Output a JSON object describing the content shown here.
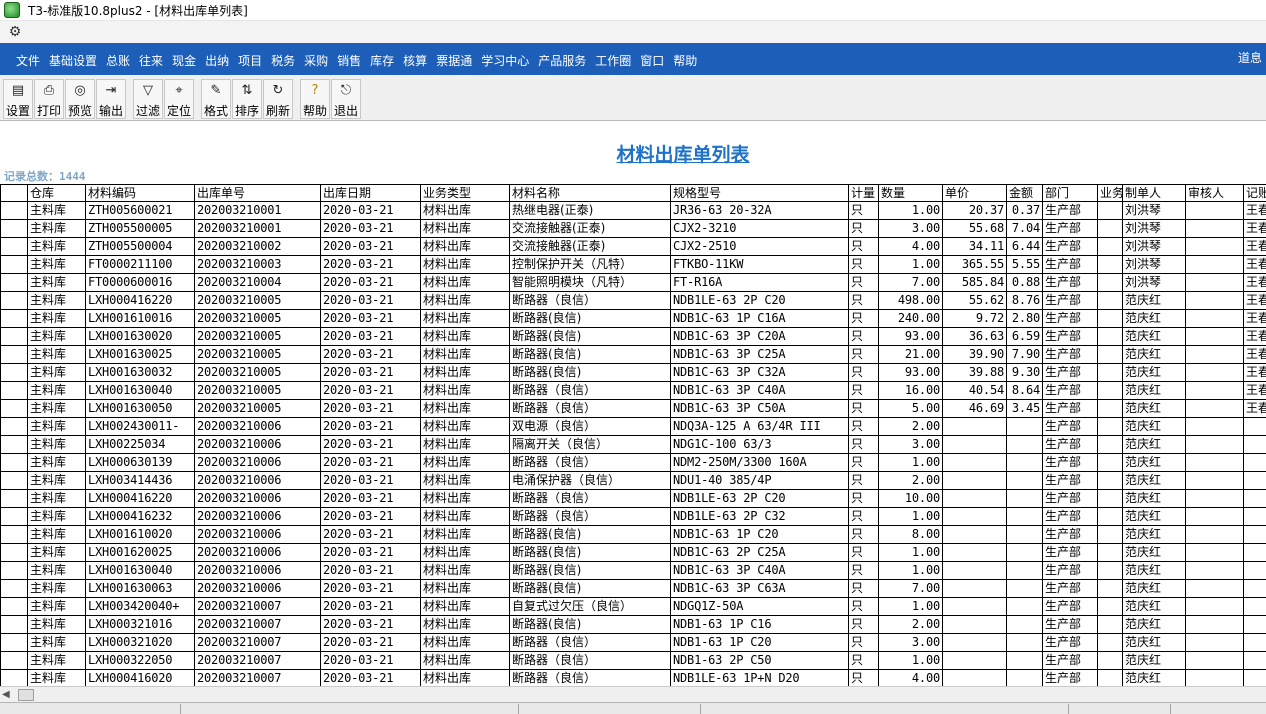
{
  "window": {
    "title": "T3-标准版10.8plus2 - [材料出库单列表]"
  },
  "menubar": {
    "items": [
      "文件",
      "基础设置",
      "总账",
      "往来",
      "现金",
      "出纳",
      "项目",
      "税务",
      "采购",
      "销售",
      "库存",
      "核算",
      "票据通",
      "学习中心",
      "产品服务",
      "工作圈",
      "窗口",
      "帮助"
    ],
    "user": "道息"
  },
  "toolbar": {
    "buttons": [
      {
        "label": "设置",
        "icon": "setup-icon"
      },
      {
        "label": "打印",
        "icon": "print-icon"
      },
      {
        "label": "预览",
        "icon": "preview-icon"
      },
      {
        "label": "输出",
        "icon": "export-icon"
      },
      {
        "label": "过滤",
        "icon": "filter-icon"
      },
      {
        "label": "定位",
        "icon": "locate-icon"
      },
      {
        "label": "格式",
        "icon": "format-icon"
      },
      {
        "label": "排序",
        "icon": "sort-icon"
      },
      {
        "label": "刷新",
        "icon": "refresh-icon"
      },
      {
        "label": "帮助",
        "icon": "help-icon"
      },
      {
        "label": "退出",
        "icon": "exit-icon"
      }
    ]
  },
  "report": {
    "title": "材料出库单列表",
    "record_count": "记录总数：1444",
    "columns": [
      "仓库",
      "材料编码",
      "出库单号",
      "出库日期",
      "业务类型",
      "材料名称",
      "规格型号",
      "计量",
      "数量",
      "单价",
      "金额",
      "部门",
      "业务",
      "制单人",
      "审核人",
      "记账"
    ],
    "rows": [
      [
        "主料库",
        "ZTH005600021",
        "202003210001",
        "2020-03-21",
        "材料出库",
        "热继电器(正泰)",
        "JR36-63 20-32A",
        "只",
        "1.00",
        "20.37",
        "0.37",
        "生产部",
        "",
        "刘洪琴",
        "",
        "王春"
      ],
      [
        "主料库",
        "ZTH005500005",
        "202003210001",
        "2020-03-21",
        "材料出库",
        "交流接触器(正泰)",
        "CJX2-3210",
        "只",
        "3.00",
        "55.68",
        "7.04",
        "生产部",
        "",
        "刘洪琴",
        "",
        "王春"
      ],
      [
        "主料库",
        "ZTH005500004",
        "202003210002",
        "2020-03-21",
        "材料出库",
        "交流接触器(正泰)",
        "CJX2-2510",
        "只",
        "4.00",
        "34.11",
        "6.44",
        "生产部",
        "",
        "刘洪琴",
        "",
        "王春"
      ],
      [
        "主料库",
        "FT0000211100",
        "202003210003",
        "2020-03-21",
        "材料出库",
        "控制保护开关（凡特）",
        "FTKBO-11KW",
        "只",
        "1.00",
        "365.55",
        "5.55",
        "生产部",
        "",
        "刘洪琴",
        "",
        "王春"
      ],
      [
        "主料库",
        "FT0000600016",
        "202003210004",
        "2020-03-21",
        "材料出库",
        "智能照明模块（凡特）",
        "FT-R16A",
        "只",
        "7.00",
        "585.84",
        "0.88",
        "生产部",
        "",
        "刘洪琴",
        "",
        "王春"
      ],
      [
        "主料库",
        "LXH000416220",
        "202003210005",
        "2020-03-21",
        "材料出库",
        "断路器（良信）",
        "NDB1LE-63 2P C20",
        "只",
        "498.00",
        "55.62",
        "8.76",
        "生产部",
        "",
        "范庆红",
        "",
        "王春"
      ],
      [
        "主料库",
        "LXH001610016",
        "202003210005",
        "2020-03-21",
        "材料出库",
        "断路器(良信)",
        "NDB1C-63 1P C16A",
        "只",
        "240.00",
        "9.72",
        "2.80",
        "生产部",
        "",
        "范庆红",
        "",
        "王春"
      ],
      [
        "主料库",
        "LXH001630020",
        "202003210005",
        "2020-03-21",
        "材料出库",
        "断路器(良信)",
        "NDB1C-63 3P C20A",
        "只",
        "93.00",
        "36.63",
        "6.59",
        "生产部",
        "",
        "范庆红",
        "",
        "王春"
      ],
      [
        "主料库",
        "LXH001630025",
        "202003210005",
        "2020-03-21",
        "材料出库",
        "断路器(良信)",
        "NDB1C-63 3P C25A",
        "只",
        "21.00",
        "39.90",
        "7.90",
        "生产部",
        "",
        "范庆红",
        "",
        "王春"
      ],
      [
        "主料库",
        "LXH001630032",
        "202003210005",
        "2020-03-21",
        "材料出库",
        "断路器(良信)",
        "NDB1C-63 3P C32A",
        "只",
        "93.00",
        "39.88",
        "9.30",
        "生产部",
        "",
        "范庆红",
        "",
        "王春"
      ],
      [
        "主料库",
        "LXH001630040",
        "202003210005",
        "2020-03-21",
        "材料出库",
        "断路器（良信）",
        "NDB1C-63 3P C40A",
        "只",
        "16.00",
        "40.54",
        "8.64",
        "生产部",
        "",
        "范庆红",
        "",
        "王春"
      ],
      [
        "主料库",
        "LXH001630050",
        "202003210005",
        "2020-03-21",
        "材料出库",
        "断路器（良信）",
        "NDB1C-63 3P C50A",
        "只",
        "5.00",
        "46.69",
        "3.45",
        "生产部",
        "",
        "范庆红",
        "",
        "王春"
      ],
      [
        "主料库",
        "LXH002430011-",
        "202003210006",
        "2020-03-21",
        "材料出库",
        "双电源（良信）",
        "NDQ3A-125 A 63/4R III",
        "只",
        "2.00",
        "",
        "",
        "生产部",
        "",
        "范庆红",
        "",
        ""
      ],
      [
        "主料库",
        "LXH00225034",
        "202003210006",
        "2020-03-21",
        "材料出库",
        "隔离开关（良信）",
        "NDG1C-100 63/3",
        "只",
        "3.00",
        "",
        "",
        "生产部",
        "",
        "范庆红",
        "",
        ""
      ],
      [
        "主料库",
        "LXH000630139",
        "202003210006",
        "2020-03-21",
        "材料出库",
        "断路器（良信）",
        "NDM2-250M/3300 160A",
        "只",
        "1.00",
        "",
        "",
        "生产部",
        "",
        "范庆红",
        "",
        ""
      ],
      [
        "主料库",
        "LXH003414436",
        "202003210006",
        "2020-03-21",
        "材料出库",
        "电涌保护器（良信）",
        "NDU1-40 385/4P",
        "只",
        "2.00",
        "",
        "",
        "生产部",
        "",
        "范庆红",
        "",
        ""
      ],
      [
        "主料库",
        "LXH000416220",
        "202003210006",
        "2020-03-21",
        "材料出库",
        "断路器（良信）",
        "NDB1LE-63 2P C20",
        "只",
        "10.00",
        "",
        "",
        "生产部",
        "",
        "范庆红",
        "",
        ""
      ],
      [
        "主料库",
        "LXH000416232",
        "202003210006",
        "2020-03-21",
        "材料出库",
        "断路器（良信）",
        "NDB1LE-63 2P C32",
        "只",
        "1.00",
        "",
        "",
        "生产部",
        "",
        "范庆红",
        "",
        ""
      ],
      [
        "主料库",
        "LXH001610020",
        "202003210006",
        "2020-03-21",
        "材料出库",
        "断路器(良信)",
        "NDB1C-63 1P C20",
        "只",
        "8.00",
        "",
        "",
        "生产部",
        "",
        "范庆红",
        "",
        ""
      ],
      [
        "主料库",
        "LXH001620025",
        "202003210006",
        "2020-03-21",
        "材料出库",
        "断路器(良信)",
        "NDB1C-63 2P C25A",
        "只",
        "1.00",
        "",
        "",
        "生产部",
        "",
        "范庆红",
        "",
        ""
      ],
      [
        "主料库",
        "LXH001630040",
        "202003210006",
        "2020-03-21",
        "材料出库",
        "断路器(良信)",
        "NDB1C-63 3P C40A",
        "只",
        "1.00",
        "",
        "",
        "生产部",
        "",
        "范庆红",
        "",
        ""
      ],
      [
        "主料库",
        "LXH001630063",
        "202003210006",
        "2020-03-21",
        "材料出库",
        "断路器(良信)",
        "NDB1C-63 3P C63A",
        "只",
        "7.00",
        "",
        "",
        "生产部",
        "",
        "范庆红",
        "",
        ""
      ],
      [
        "主料库",
        "LXH003420040+",
        "202003210007",
        "2020-03-21",
        "材料出库",
        "自复式过欠压（良信）",
        "NDGQ1Z-50A",
        "只",
        "1.00",
        "",
        "",
        "生产部",
        "",
        "范庆红",
        "",
        ""
      ],
      [
        "主料库",
        "LXH000321016",
        "202003210007",
        "2020-03-21",
        "材料出库",
        "断路器(良信)",
        "NDB1-63  1P C16",
        "只",
        "2.00",
        "",
        "",
        "生产部",
        "",
        "范庆红",
        "",
        ""
      ],
      [
        "主料库",
        "LXH000321020",
        "202003210007",
        "2020-03-21",
        "材料出库",
        "断路器（良信）",
        "NDB1-63  1P C20",
        "只",
        "3.00",
        "",
        "",
        "生产部",
        "",
        "范庆红",
        "",
        ""
      ],
      [
        "主料库",
        "LXH000322050",
        "202003210007",
        "2020-03-21",
        "材料出库",
        "断路器（良信）",
        "NDB1-63  2P C50",
        "只",
        "1.00",
        "",
        "",
        "生产部",
        "",
        "范庆红",
        "",
        ""
      ],
      [
        "主料库",
        "LXH000416020",
        "202003210007",
        "2020-03-21",
        "材料出库",
        "断路器（良信）",
        "NDB1LE-63 1P+N D20",
        "只",
        "4.00",
        "",
        "",
        "生产部",
        "",
        "范庆红",
        "",
        ""
      ]
    ]
  }
}
